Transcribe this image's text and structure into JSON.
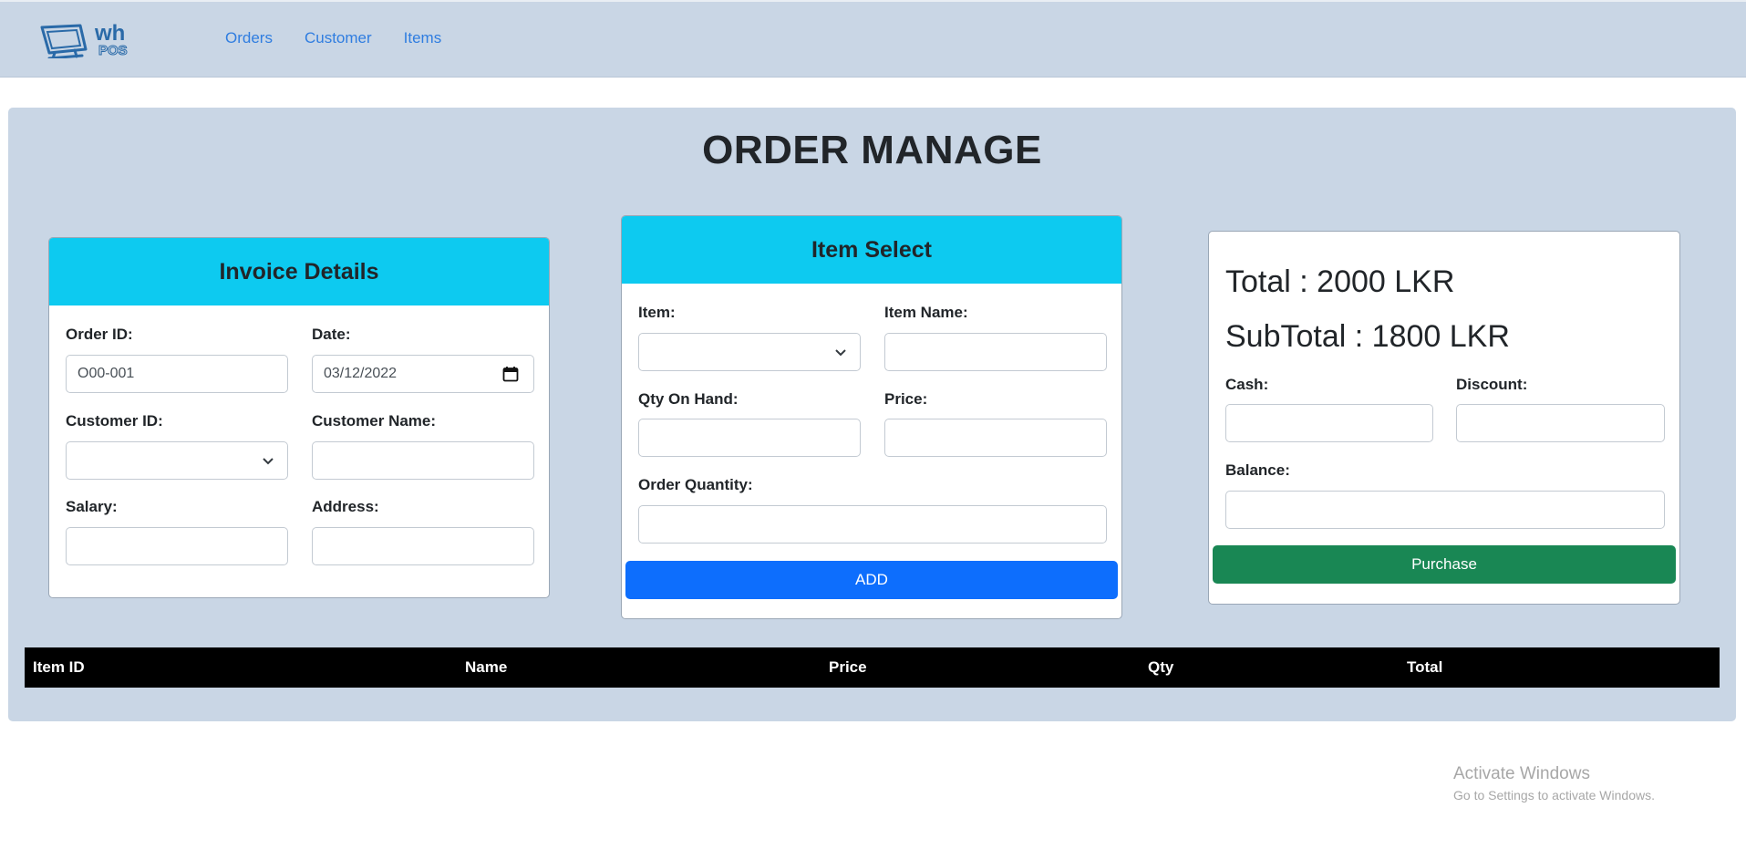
{
  "nav": {
    "logo_top": "wh",
    "logo_bottom": "POS",
    "links": [
      "Orders",
      "Customer",
      "Items"
    ]
  },
  "page": {
    "title": "ORDER MANAGE"
  },
  "invoice": {
    "header": "Invoice Details",
    "order_id_label": "Order ID:",
    "order_id_value": "O00-001",
    "date_label": "Date:",
    "date_value": "03/12/2022",
    "customer_id_label": "Customer ID:",
    "customer_id_value": "",
    "customer_name_label": "Customer Name:",
    "customer_name_value": "",
    "salary_label": "Salary:",
    "salary_value": "",
    "address_label": "Address:",
    "address_value": ""
  },
  "item_select": {
    "header": "Item Select",
    "item_label": "Item:",
    "item_value": "",
    "item_name_label": "Item Name:",
    "item_name_value": "",
    "qty_label": "Qty On Hand:",
    "qty_value": "",
    "price_label": "Price:",
    "price_value": "",
    "order_qty_label": "Order Quantity:",
    "order_qty_value": "",
    "add_button": "ADD"
  },
  "summary": {
    "total": "Total : 2000 LKR",
    "subtotal": "SubTotal : 1800 LKR",
    "cash_label": "Cash:",
    "cash_value": "",
    "discount_label": "Discount:",
    "discount_value": "",
    "balance_label": "Balance:",
    "balance_value": "",
    "purchase_button": "Purchase"
  },
  "table": {
    "columns": [
      "Item ID",
      "Name",
      "Price",
      "Qty",
      "Total"
    ],
    "rows": []
  },
  "watermark": {
    "title": "Activate Windows",
    "subtitle": "Go to Settings to activate Windows."
  },
  "colors": {
    "navbar_bg": "#c9d6e5",
    "card_header": "#0dcaf0",
    "add_button": "#0d6efd",
    "purchase_button": "#198754",
    "link": "#2f7de0"
  },
  "icons": [
    "pos-monitor-logo-icon",
    "chevron-down-icon",
    "calendar-icon"
  ]
}
